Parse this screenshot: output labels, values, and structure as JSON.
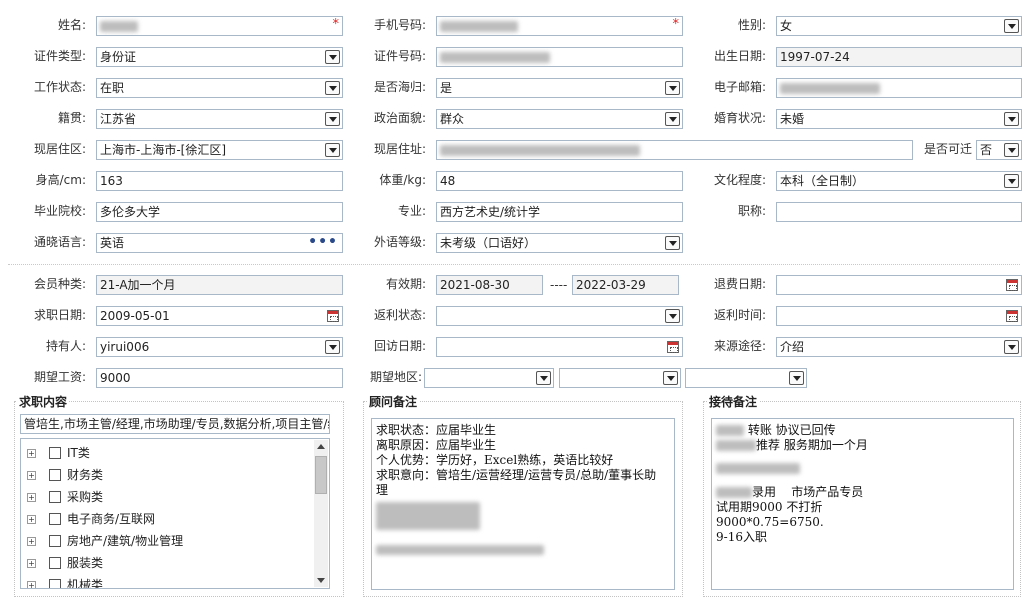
{
  "fields": {
    "name": {
      "label": "姓名:"
    },
    "phone": {
      "label": "手机号码:"
    },
    "gender": {
      "label": "性别:",
      "value": "女"
    },
    "id_type": {
      "label": "证件类型:",
      "value": "身份证"
    },
    "id_number": {
      "label": "证件号码:"
    },
    "birth_date": {
      "label": "出生日期:",
      "value": "1997-07-24"
    },
    "work_status": {
      "label": "工作状态:",
      "value": "在职"
    },
    "returnee": {
      "label": "是否海归:",
      "value": "是"
    },
    "email": {
      "label": "电子邮箱:"
    },
    "native_place": {
      "label": "籍贯:",
      "value": "江苏省"
    },
    "political_status": {
      "label": "政治面貌:",
      "value": "群众"
    },
    "marital_status": {
      "label": "婚育状况:",
      "value": "未婚"
    },
    "residence_area": {
      "label": "现居住区:",
      "value": "上海市-上海市-[徐汇区]"
    },
    "residence_address": {
      "label": "现居住址:"
    },
    "relocatable": {
      "label": "是否可迁",
      "value": "否"
    },
    "height": {
      "label": "身高/cm:",
      "value": "163"
    },
    "weight": {
      "label": "体重/kg:",
      "value": "48"
    },
    "education": {
      "label": "文化程度:",
      "value": "本科（全日制）"
    },
    "school": {
      "label": "毕业院校:",
      "value": "多伦多大学"
    },
    "major": {
      "label": "专业:",
      "value": "西方艺术史/统计学"
    },
    "title": {
      "label": "职称:",
      "value": ""
    },
    "languages": {
      "label": "通晓语言:",
      "value": "英语"
    },
    "language_level": {
      "label": "外语等级:",
      "value": "未考级（口语好）"
    },
    "membership_type": {
      "label": "会员种类:",
      "value": "21-A加一个月"
    },
    "valid_period": {
      "label": "有效期:",
      "from": "2021-08-30",
      "sep": "----",
      "to": "2022-03-29"
    },
    "refund_date": {
      "label": "退费日期:",
      "value": ""
    },
    "job_seek_date": {
      "label": "求职日期:",
      "value": "2009-05-01"
    },
    "rebate_status": {
      "label": "返利状态:",
      "value": ""
    },
    "rebate_time": {
      "label": "返利时间:",
      "value": ""
    },
    "holder": {
      "label": "持有人:",
      "value": "yirui006"
    },
    "revisit_date": {
      "label": "回访日期:",
      "value": ""
    },
    "source": {
      "label": "来源途径:",
      "value": "介绍"
    },
    "expected_salary": {
      "label": "期望工资:",
      "value": "9000"
    },
    "expected_region": {
      "label": "期望地区:",
      "v1": "",
      "v2": "",
      "v3": ""
    }
  },
  "job_content": {
    "title": "求职内容",
    "summary": "管培生,市场主管/经理,市场助理/专员,数据分析,项目主管/经",
    "tree": [
      "IT类",
      "财务类",
      "采购类",
      "电子商务/互联网",
      "房地产/建筑/物业管理",
      "服装类",
      "机械类"
    ]
  },
  "consultant_notes": {
    "title": "顾问备注",
    "lines": [
      "求职状态：应届毕业生",
      "离职原因：应届毕业生",
      "个人优势：学历好，Excel熟练，英语比较好",
      "求职意向：管培生/运营经理/运营专员/总助/董事长助",
      "理"
    ]
  },
  "reception_notes": {
    "title": "接待备注",
    "l1": "转账 协议已回传",
    "l2": "推荐 服务期加一个月",
    "l4a": "录用",
    "l4b": "市场产品专员",
    "l5": "试用期9000   不打折",
    "l6": "9000*0.75=6750.",
    "l7": "9-16入职"
  }
}
